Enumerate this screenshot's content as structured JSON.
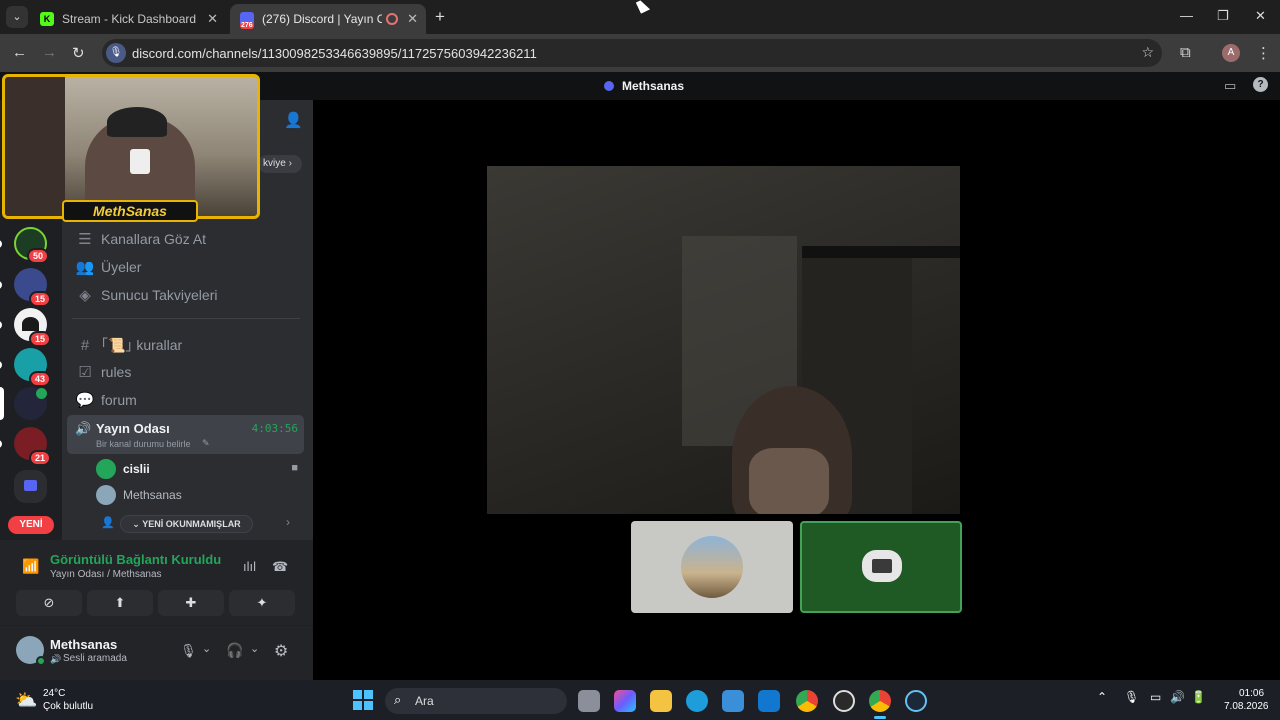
{
  "browser": {
    "tabs": [
      {
        "title": "Stream - Kick Dashboard"
      },
      {
        "title": "(276) Discord | Yayın Odası",
        "badge": "276"
      }
    ],
    "url": "discord.com/channels/1130098253346639895/1172575603942236211",
    "profile_initial": "A"
  },
  "discord": {
    "title_bar": "Methsanas",
    "boost_partial": "kviye",
    "servers": [
      {
        "badge": "50"
      },
      {
        "badge": "15"
      },
      {
        "badge": "15"
      },
      {
        "badge": "43"
      },
      {
        "badge": ""
      },
      {
        "badge": "21"
      }
    ],
    "new_pill": "YENİ",
    "menu_items": [
      "Kanallara Göz At",
      "Üyeler",
      "Sunucu Takviyeleri"
    ],
    "channels": [
      {
        "name": "｢📜｣ kurallar"
      },
      {
        "name": "rules"
      },
      {
        "name": "forum"
      }
    ],
    "voice_channel": {
      "name": "Yayın Odası",
      "timer": "4:03:56",
      "status_hint": "Bir kanal durumu belirle",
      "members": [
        "cislii",
        "Methsanas"
      ]
    },
    "unread_button": "YENİ OKUNMAMIŞLAR",
    "connection": {
      "status": "Görüntülü Bağlantı Kuruldu",
      "location": "Yayın Odası / Methsanas"
    },
    "user": {
      "name": "Methsanas",
      "status": "Sesli aramada"
    },
    "colors": {
      "accent_green": "#23a55a",
      "badge_red": "#f23f43"
    }
  },
  "overlay": {
    "streamer_name": "MethSanas"
  },
  "taskbar": {
    "weather_temp": "24°C",
    "weather_desc": "Çok bulutlu",
    "search_label": "Ara",
    "time": "01:06",
    "date": "7.08.2026"
  }
}
